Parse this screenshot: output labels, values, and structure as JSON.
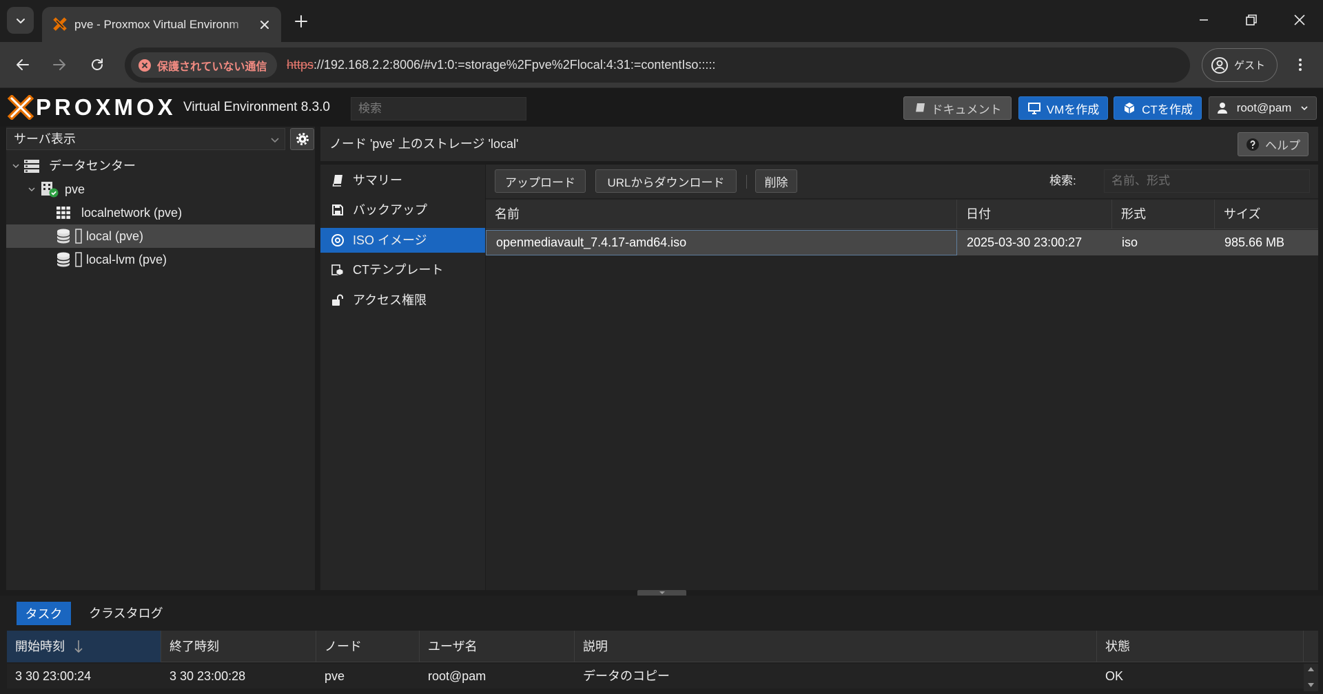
{
  "browser": {
    "tab_title": "pve - Proxmox Virtual Environm",
    "security_label": "保護されていない通信",
    "url_scheme": "https",
    "url_rest": "://192.168.2.2:8006/#v1:0:=storage%2Fpve%2Flocal:4:31:=contentIso:::::",
    "profile_label": "ゲスト"
  },
  "header": {
    "logo_text": "PROXMOX",
    "version": "Virtual Environment 8.3.0",
    "search_placeholder": "検索",
    "docs_button": "ドキュメント",
    "create_vm_button": "VMを作成",
    "create_ct_button": "CTを作成",
    "user_button": "root@pam"
  },
  "tree": {
    "view_selector": "サーバ表示",
    "items": [
      {
        "label": "データセンター",
        "icon": "datacenter-icon"
      },
      {
        "label": "pve",
        "icon": "node-online-icon"
      },
      {
        "label": "localnetwork (pve)",
        "icon": "sdn-zone-icon"
      },
      {
        "label": "local (pve)",
        "icon": "storage-icon",
        "selected": true
      },
      {
        "label": "local-lvm (pve)",
        "icon": "storage-icon"
      }
    ]
  },
  "content": {
    "title": "ノード 'pve' 上のストレージ 'local'",
    "help_button": "ヘルプ",
    "nav": [
      {
        "label": "サマリー",
        "icon": "book-icon"
      },
      {
        "label": "バックアップ",
        "icon": "floppy-icon"
      },
      {
        "label": "ISO イメージ",
        "icon": "disc-icon",
        "selected": true
      },
      {
        "label": "CTテンプレート",
        "icon": "ct-template-icon"
      },
      {
        "label": "アクセス権限",
        "icon": "unlock-icon"
      }
    ],
    "toolbar": {
      "upload_button": "アップロード",
      "download_url_button": "URLからダウンロード",
      "delete_button": "削除",
      "search_label": "検索:",
      "search_placeholder": "名前、形式"
    },
    "grid": {
      "columns": [
        "名前",
        "日付",
        "形式",
        "サイズ"
      ],
      "rows": [
        [
          "openmediavault_7.4.17-amd64.iso",
          "2025-03-30 23:00:27",
          "iso",
          "985.66 MB"
        ]
      ]
    }
  },
  "tasks": {
    "tabs": [
      "タスク",
      "クラスタログ"
    ],
    "active_tab_index": 0,
    "columns": [
      "開始時刻",
      "終了時刻",
      "ノード",
      "ユーザ名",
      "説明",
      "状態"
    ],
    "sort_column_index": 0,
    "sort_icon": "arrow-down-icon",
    "rows": [
      [
        "3 30 23:00:24",
        "3 30 23:00:28",
        "pve",
        "root@pam",
        "データのコピー",
        "OK"
      ]
    ]
  },
  "colors": {
    "accent_blue": "#1a66c0",
    "logo_orange": "#e57000",
    "node_online_green": "#2ea043",
    "insecure_red": "#f28b82"
  }
}
